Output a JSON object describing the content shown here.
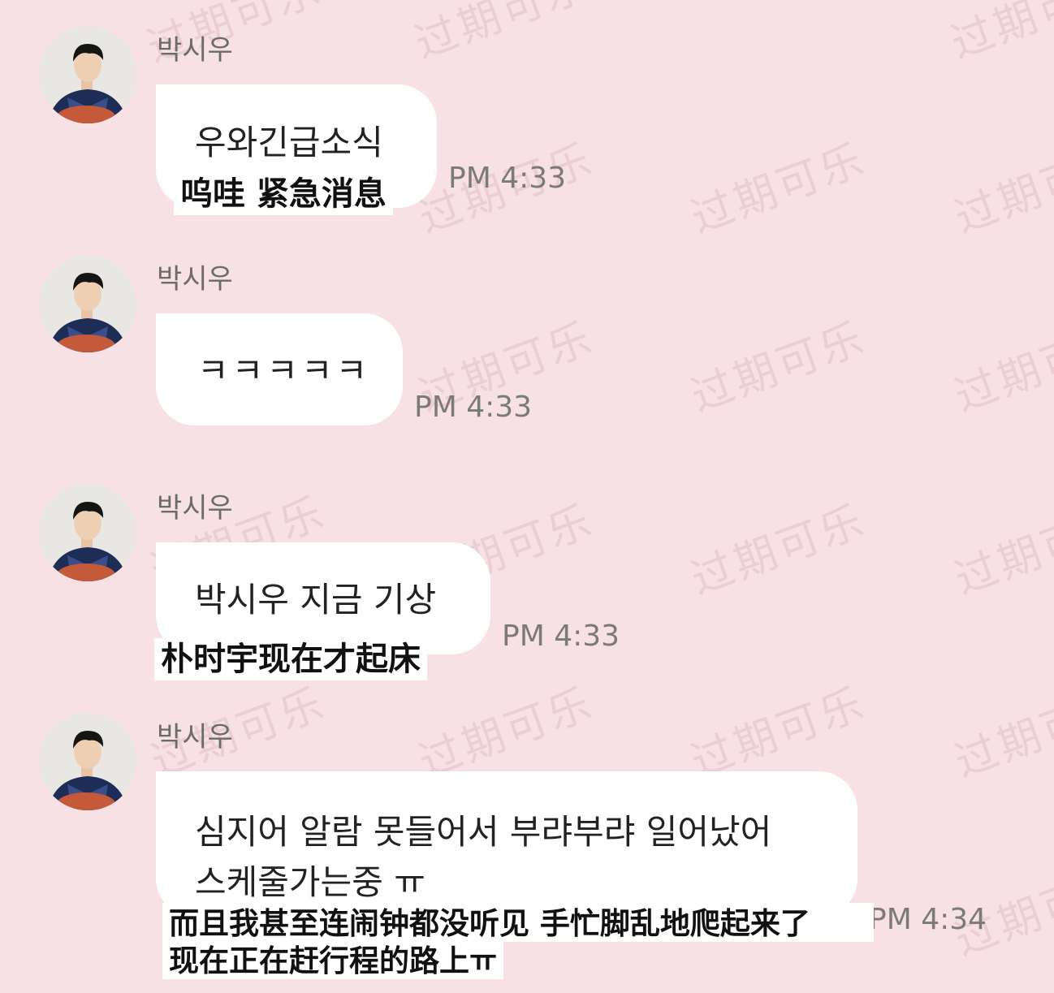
{
  "watermark_text": "过期可乐",
  "messages": [
    {
      "sender": "박시우",
      "text_lines": [
        "우와긴급소식"
      ],
      "subtitle_lines": [
        "呜哇 紧急消息"
      ],
      "time": "PM 4:33"
    },
    {
      "sender": "박시우",
      "text_lines": [
        "ㅋㅋㅋㅋㅋ"
      ],
      "subtitle_lines": [],
      "time": "PM 4:33"
    },
    {
      "sender": "박시우",
      "text_lines": [
        "박시우 지금 기상"
      ],
      "subtitle_lines": [
        "朴时宇现在才起床"
      ],
      "time": "PM 4:33"
    },
    {
      "sender": "박시우",
      "text_lines": [
        "심지어 알람 못들어서 부랴부랴 일어났어",
        "스케줄가는중 ㅠ"
      ],
      "subtitle_lines": [
        "而且我甚至连闹钟都没听见 手忙脚乱地爬起来了",
        "现在正在赶行程的路上ㅠ"
      ],
      "time": "PM 4:34"
    }
  ],
  "colors": {
    "background": "#f7e1e4",
    "bubble": "#ffffff",
    "time_text": "#7a7a7a",
    "sender_text": "#6b6b6b"
  }
}
